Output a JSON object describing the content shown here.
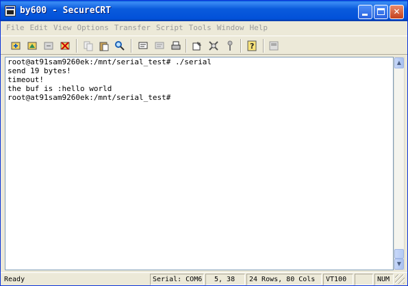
{
  "window": {
    "title": "by600 - SecureCRT"
  },
  "menu": [
    "File",
    "Edit",
    "View",
    "Options",
    "Transfer",
    "Script",
    "Tools",
    "Window",
    "Help"
  ],
  "terminal": {
    "lines": [
      "root@at91sam9260ek:/mnt/serial_test# ./serial",
      "send 19 bytes!",
      "timeout!",
      "the buf is :hello world",
      "root@at91sam9260ek:/mnt/serial_test#"
    ]
  },
  "status": {
    "ready": "Ready",
    "connection": "Serial: COM6",
    "cursor": "5,  38",
    "size": "24 Rows,  80 Cols",
    "emulation": "VT100",
    "num": "NUM"
  }
}
